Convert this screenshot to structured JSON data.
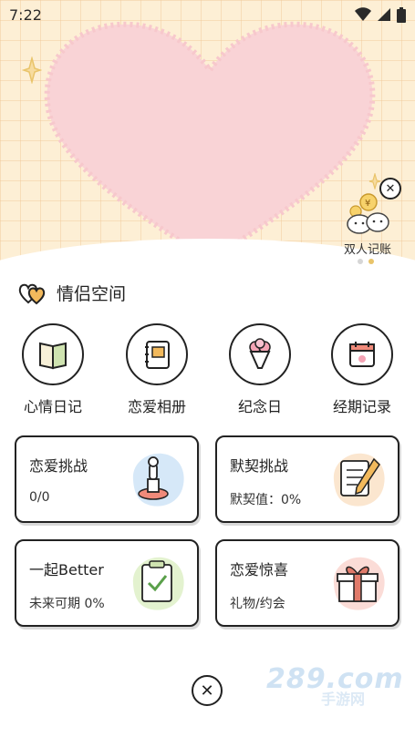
{
  "status_bar": {
    "time": "7:22"
  },
  "ledger": {
    "label": "双人记账",
    "close_glyph": "✕"
  },
  "section": {
    "title": "情侣空间"
  },
  "features": [
    {
      "label": "心情日记",
      "icon": "diary-book-icon"
    },
    {
      "label": "恋爱相册",
      "icon": "photo-album-icon"
    },
    {
      "label": "纪念日",
      "icon": "bouquet-icon"
    },
    {
      "label": "经期记录",
      "icon": "calendar-icon"
    }
  ],
  "cards": [
    {
      "title": "恋爱挑战",
      "sub": "0/0",
      "icon": "stamp-icon",
      "blob": "#d6e8f8"
    },
    {
      "title": "默契挑战",
      "sub": "默契值：0%",
      "icon": "writing-pad-icon",
      "blob": "#fbe6cf"
    },
    {
      "title": "一起Better",
      "sub": "未来可期 0%",
      "icon": "checklist-icon",
      "blob": "#e3f2cf"
    },
    {
      "title": "恋爱惊喜",
      "sub": "礼物/约会",
      "icon": "gift-box-icon",
      "blob": "#fbdcd7"
    }
  ],
  "bottom": {
    "close_glyph": "✕"
  },
  "watermark": {
    "main": "289.com",
    "sub": "手游网"
  },
  "colors": {
    "hero_bg": "#fdefd5",
    "heart": "#f9d3d6",
    "accent_yellow": "#e9c46a"
  }
}
